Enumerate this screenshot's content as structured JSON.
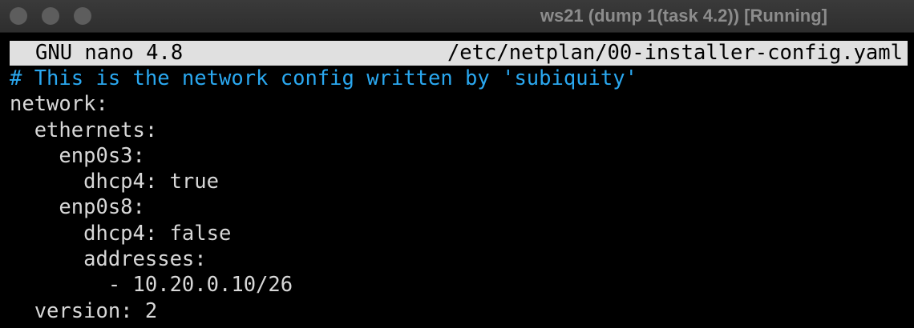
{
  "window": {
    "title": "ws21 (dump 1(task 4.2)) [Running]",
    "buttons": [
      "close",
      "minimize",
      "maximize"
    ]
  },
  "nano": {
    "version": "GNU nano 4.8",
    "filename": "/etc/netplan/00-installer-config.yaml"
  },
  "file_lines": [
    "# This is the network config written by 'subiquity'",
    "network:",
    "  ethernets:",
    "    enp0s3:",
    "      dhcp4: true",
    "    enp0s8:",
    "      dhcp4: false",
    "      addresses:",
    "        - 10.20.0.10/26",
    "  version: 2"
  ],
  "colors": {
    "comment": "#2aa8f0",
    "text": "#d8d8d8",
    "header_bg": "#e0e0e0",
    "background": "#000000"
  }
}
